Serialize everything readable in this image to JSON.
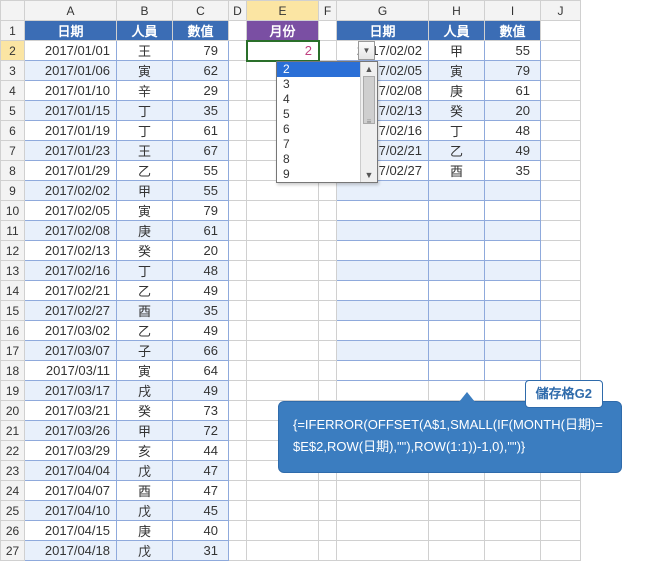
{
  "col_letters": [
    "A",
    "B",
    "C",
    "D",
    "E",
    "F",
    "G",
    "H",
    "I",
    "J"
  ],
  "row_numbers": [
    "1",
    "2",
    "3",
    "4",
    "5",
    "6",
    "7",
    "8",
    "9",
    "10",
    "11",
    "12",
    "13",
    "14",
    "15",
    "16",
    "17",
    "18",
    "19",
    "20",
    "21",
    "22",
    "23",
    "24",
    "25",
    "26",
    "27"
  ],
  "headers": {
    "date": "日期",
    "person": "人員",
    "value": "數值",
    "month": "月份"
  },
  "selected_month": "2",
  "dropdown_options": [
    "2",
    "3",
    "4",
    "5",
    "6",
    "7",
    "8",
    "9"
  ],
  "left_rows": [
    {
      "date": "2017/01/01",
      "person": "王",
      "value": "79"
    },
    {
      "date": "2017/01/06",
      "person": "寅",
      "value": "62"
    },
    {
      "date": "2017/01/10",
      "person": "辛",
      "value": "29"
    },
    {
      "date": "2017/01/15",
      "person": "丁",
      "value": "35"
    },
    {
      "date": "2017/01/19",
      "person": "丁",
      "value": "61"
    },
    {
      "date": "2017/01/23",
      "person": "王",
      "value": "67"
    },
    {
      "date": "2017/01/29",
      "person": "乙",
      "value": "55"
    },
    {
      "date": "2017/02/02",
      "person": "甲",
      "value": "55"
    },
    {
      "date": "2017/02/05",
      "person": "寅",
      "value": "79"
    },
    {
      "date": "2017/02/08",
      "person": "庚",
      "value": "61"
    },
    {
      "date": "2017/02/13",
      "person": "癸",
      "value": "20"
    },
    {
      "date": "2017/02/16",
      "person": "丁",
      "value": "48"
    },
    {
      "date": "2017/02/21",
      "person": "乙",
      "value": "49"
    },
    {
      "date": "2017/02/27",
      "person": "酉",
      "value": "35"
    },
    {
      "date": "2017/03/02",
      "person": "乙",
      "value": "49"
    },
    {
      "date": "2017/03/07",
      "person": "子",
      "value": "66"
    },
    {
      "date": "2017/03/11",
      "person": "寅",
      "value": "64"
    },
    {
      "date": "2017/03/17",
      "person": "戌",
      "value": "49"
    },
    {
      "date": "2017/03/21",
      "person": "癸",
      "value": "73"
    },
    {
      "date": "2017/03/26",
      "person": "甲",
      "value": "72"
    },
    {
      "date": "2017/03/29",
      "person": "亥",
      "value": "44"
    },
    {
      "date": "2017/04/04",
      "person": "戊",
      "value": "47"
    },
    {
      "date": "2017/04/07",
      "person": "酉",
      "value": "47"
    },
    {
      "date": "2017/04/10",
      "person": "戊",
      "value": "45"
    },
    {
      "date": "2017/04/15",
      "person": "庚",
      "value": "40"
    },
    {
      "date": "2017/04/18",
      "person": "戊",
      "value": "31"
    }
  ],
  "right_rows": [
    {
      "date": "2017/02/02",
      "person": "甲",
      "value": "55"
    },
    {
      "date": "2017/02/05",
      "person": "寅",
      "value": "79"
    },
    {
      "date": "2017/02/08",
      "person": "庚",
      "value": "61"
    },
    {
      "date": "2017/02/13",
      "person": "癸",
      "value": "20"
    },
    {
      "date": "2017/02/16",
      "person": "丁",
      "value": "48"
    },
    {
      "date": "2017/02/21",
      "person": "乙",
      "value": "49"
    },
    {
      "date": "2017/02/27",
      "person": "酉",
      "value": "35"
    }
  ],
  "right_empty_rows": 10,
  "callout": {
    "label": "儲存格G2",
    "formula": "{=IFERROR(OFFSET(A$1,SMALL(IF(MONTH(日期)=$E$2,ROW(日期),\"\"),ROW(1:1))-1,0),\"\")}"
  }
}
